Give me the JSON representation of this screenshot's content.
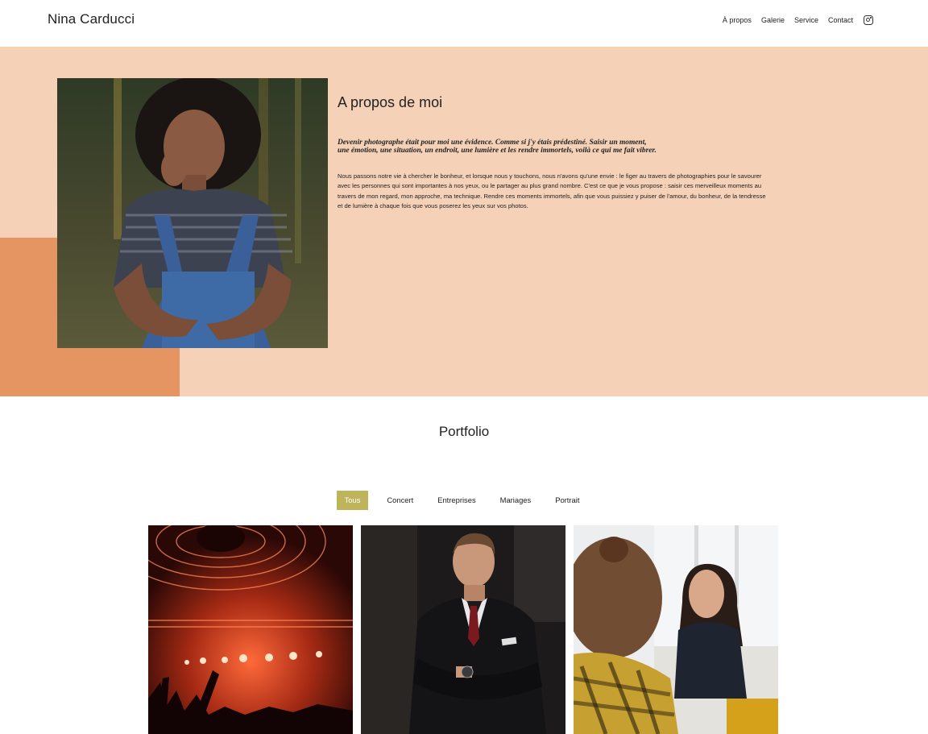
{
  "header": {
    "brand": "Nina Carducci",
    "nav": [
      "À propos",
      "Galerie",
      "Service",
      "Contact"
    ]
  },
  "about": {
    "title": "A propos de moi",
    "quote": "Devenir photographe était pour moi une évidence. Comme si j'y étais prédestiné. Saisir un moment, une émotion, une situation, un endroit, une lumière et les rendre immortels, voilà ce qui me fait vibrer.",
    "body": "Nous passons notre vie à chercher le bonheur, et lorsque nous y touchons, nous n'avons qu'une envie : le figer au travers de photographies pour le savourer avec les personnes qui sont importantes à nos yeux, ou le partager au plus grand nombre. C'est ce que je vous propose : saisir ces merveilleux moments au travers de mon regard, mon approche, ma technique. Rendre ces moments immortels, afin que vous puissiez y puiser de l'amour, du bonheur, de la tendresse et de lumière à chaque fois que vous poserez les yeux sur vos photos."
  },
  "portfolio": {
    "title": "Portfolio",
    "filters": [
      "Tous",
      "Concert",
      "Entreprises",
      "Mariages",
      "Portrait"
    ],
    "active_filter": "Tous"
  },
  "colors": {
    "about_bg": "#f5d1b7",
    "accent": "#e59562",
    "filter_active": "#beb45a"
  }
}
